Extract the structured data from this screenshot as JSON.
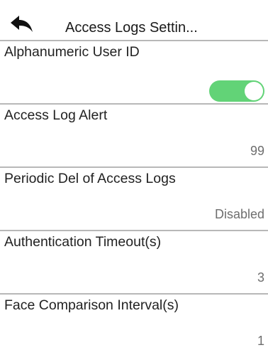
{
  "header": {
    "title": "Access Logs Settin..."
  },
  "settings": [
    {
      "label": "Alphanumeric User ID",
      "control": "toggle",
      "enabled": true
    },
    {
      "label": "Access Log Alert",
      "value": "99"
    },
    {
      "label": "Periodic Del of Access Logs",
      "value": "Disabled"
    },
    {
      "label": "Authentication Timeout(s)",
      "value": "3"
    },
    {
      "label": "Face Comparison Interval(s)",
      "value": "1"
    }
  ],
  "colors": {
    "toggle_on": "#62d377",
    "divider": "#b8b8b8",
    "value_text": "#6e6e6e"
  }
}
